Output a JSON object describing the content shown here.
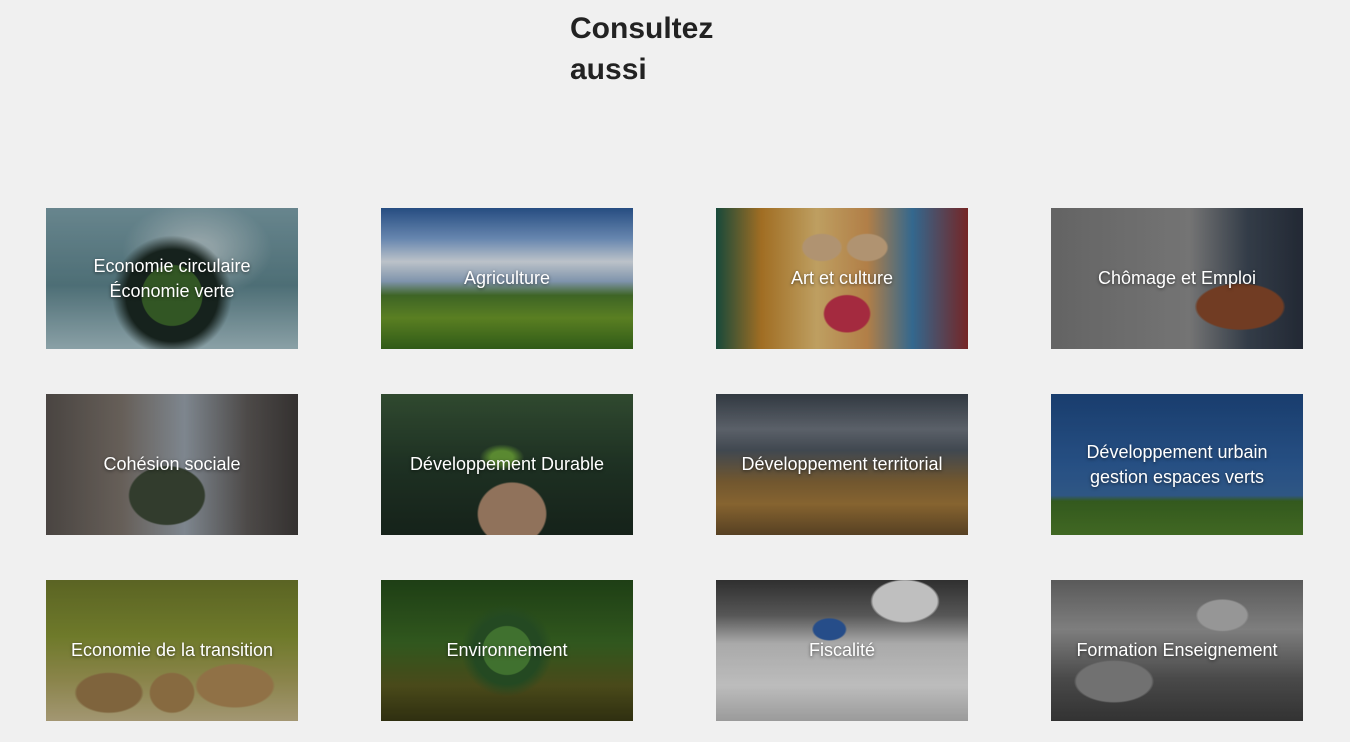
{
  "header": {
    "title": "Consultez aussi"
  },
  "tiles": [
    {
      "lines": [
        "Economie circulaire",
        "Économie verte"
      ]
    },
    {
      "lines": [
        "Agriculture"
      ]
    },
    {
      "lines": [
        "Art et culture"
      ]
    },
    {
      "lines": [
        "Chômage et Emploi"
      ]
    },
    {
      "lines": [
        "Cohésion sociale"
      ]
    },
    {
      "lines": [
        "Développement Durable"
      ]
    },
    {
      "lines": [
        "Développement territorial"
      ]
    },
    {
      "lines": [
        "Développement urbain",
        "gestion espaces verts"
      ]
    },
    {
      "lines": [
        "Economie de la transition"
      ]
    },
    {
      "lines": [
        "Environnement"
      ]
    },
    {
      "lines": [
        "Fiscalité"
      ]
    },
    {
      "lines": [
        "Formation Enseignement"
      ]
    }
  ]
}
